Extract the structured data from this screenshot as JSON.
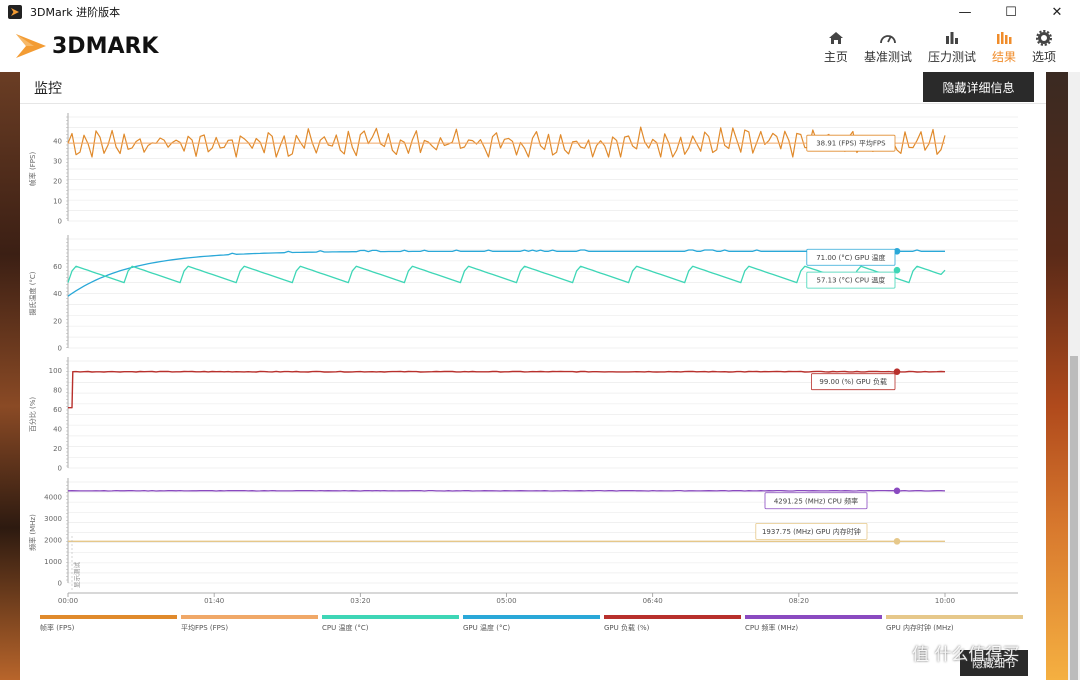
{
  "window": {
    "title": "3DMark 进阶版本",
    "controls": [
      "—",
      "☐",
      "✕"
    ]
  },
  "header": {
    "logo_text": "3DMARK",
    "nav": [
      {
        "label": "主页",
        "icon": "home-icon"
      },
      {
        "label": "基准测试",
        "icon": "gauge-icon"
      },
      {
        "label": "压力测试",
        "icon": "bar-chart-icon"
      },
      {
        "label": "结果",
        "icon": "results-icon",
        "active": true
      },
      {
        "label": "选项",
        "icon": "gear-icon"
      }
    ]
  },
  "panel": {
    "title": "监控",
    "hide_details_label": "隐藏详细信息",
    "bottom_button_label": "隐藏细节"
  },
  "watermark": "值 什么值得买",
  "colors": {
    "fps": "#e08a2c",
    "avg_fps": "#f0a868",
    "cpu_temp": "#3ed6b6",
    "gpu_temp": "#2aa8d8",
    "gpu_load": "#b8302c",
    "cpu_clock": "#8a4ac0",
    "gpu_mem_clock": "#e6c88a",
    "accent": "#f08c2a"
  },
  "chart_data": [
    {
      "type": "line",
      "ylabel": "帧率 (FPS)",
      "yticks": [
        0,
        10,
        20,
        30,
        40
      ],
      "ylim": [
        0,
        52
      ],
      "series": [
        {
          "name": "帧率 (FPS)",
          "pattern": "oscillating",
          "min": 32,
          "max": 48,
          "mean": 39
        },
        {
          "name": "平均FPS (FPS)",
          "constant": 38.91
        }
      ],
      "tooltip": {
        "value": "38.91",
        "unit": "(FPS)",
        "label": "平均FPS"
      }
    },
    {
      "type": "line",
      "ylabel": "摄氏温度 (°C)",
      "yticks": [
        0,
        20,
        40,
        60
      ],
      "ylim": [
        0,
        80
      ],
      "series": [
        {
          "name": "GPU 温度 (°C)",
          "start": 38,
          "end": 71.0
        },
        {
          "name": "CPU 温度 (°C)",
          "pattern": "sawtooth",
          "min": 44,
          "max": 64,
          "last": 57.13
        }
      ],
      "tooltips": [
        {
          "value": "71.00",
          "unit": "(°C)",
          "label": "GPU 温度"
        },
        {
          "value": "57.13",
          "unit": "(°C)",
          "label": "CPU 温度"
        }
      ]
    },
    {
      "type": "line",
      "ylabel": "百分比 (%)",
      "yticks": [
        0,
        20,
        40,
        60,
        80,
        100
      ],
      "ylim": [
        0,
        110
      ],
      "series": [
        {
          "name": "GPU 负载 (%)",
          "start": 62,
          "end": 99.0
        }
      ],
      "tooltip": {
        "value": "99.00",
        "unit": "(%)",
        "label": "GPU 负载"
      }
    },
    {
      "type": "line",
      "ylabel": "频率 (MHz)",
      "yticks": [
        0,
        1000,
        2000,
        3000,
        4000
      ],
      "ylim": [
        0,
        4700
      ],
      "series": [
        {
          "name": "CPU 频率 (MHz)",
          "constant": 4291.25
        },
        {
          "name": "GPU 内存时钟 (MHz)",
          "constant": 1937.75
        }
      ],
      "tooltips": [
        {
          "value": "4291.25",
          "unit": "(MHz)",
          "label": "CPU 频率"
        },
        {
          "value": "1937.75",
          "unit": "(MHz)",
          "label": "GPU 内存时钟"
        }
      ],
      "annotation": "显示测试"
    }
  ],
  "x_axis": {
    "ticks": [
      "00:00",
      "01:40",
      "03:20",
      "05:00",
      "06:40",
      "08:20",
      "10:00"
    ]
  },
  "legend": [
    {
      "label": "帧率 (FPS)",
      "color": "#e08a2c"
    },
    {
      "label": "平均FPS (FPS)",
      "color": "#f0a868"
    },
    {
      "label": "CPU 温度 (°C)",
      "color": "#3ed6b6"
    },
    {
      "label": "GPU 温度 (°C)",
      "color": "#2aa8d8"
    },
    {
      "label": "GPU 负载 (%)",
      "color": "#b8302c"
    },
    {
      "label": "CPU 频率 (MHz)",
      "color": "#8a4ac0"
    },
    {
      "label": "GPU 内存时钟 (MHz)",
      "color": "#e6c88a"
    }
  ]
}
